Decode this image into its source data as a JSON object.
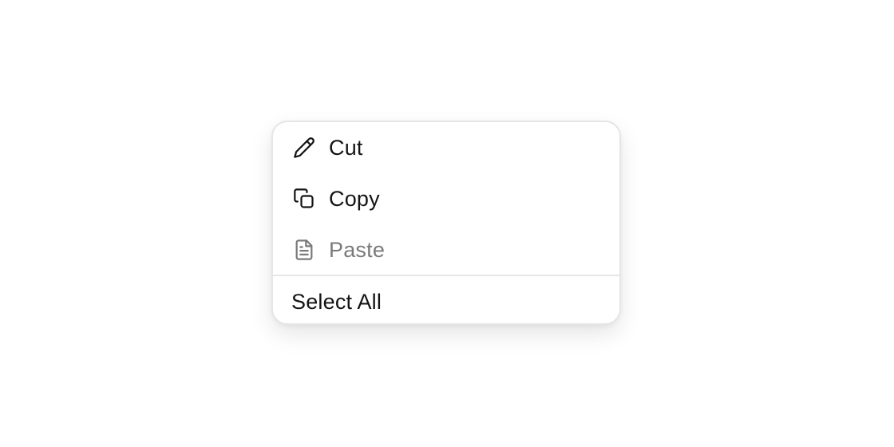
{
  "context_menu": {
    "items": [
      {
        "label": "Cut",
        "icon": "pencil-icon",
        "enabled": true
      },
      {
        "label": "Copy",
        "icon": "copy-icon",
        "enabled": true
      },
      {
        "label": "Paste",
        "icon": "document-icon",
        "enabled": false
      }
    ],
    "select_all_label": "Select All"
  },
  "colors": {
    "text": "#141414",
    "disabled_text": "#7a7a7a",
    "border": "#e6e6e6",
    "background": "#ffffff"
  }
}
